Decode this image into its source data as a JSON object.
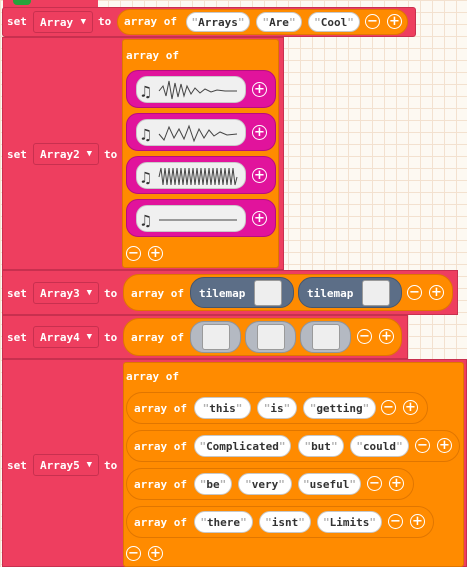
{
  "keywords": {
    "set": "set",
    "to": "to",
    "array_of": "array of"
  },
  "icons": {
    "remove": "minus-circle-icon",
    "add": "plus-circle-icon",
    "note": "music-note-icon",
    "dropdown": "triangle-down-icon"
  },
  "colors": {
    "set_block": "#ee3e5f",
    "array_block": "#ff8b00",
    "sound_block": "#e1139c",
    "tilemap_block": "#5c6e87",
    "image_block": "#b4b9c2"
  },
  "blocks": [
    {
      "variable": "Array",
      "items": [
        "Arrays",
        "Are",
        "Cool"
      ]
    },
    {
      "variable": "Array2",
      "items": [
        "sound-wave-1",
        "sound-wave-2",
        "sound-wave-3",
        "sound-wave-4"
      ]
    },
    {
      "variable": "Array3",
      "items": [
        "tilemap",
        "tilemap"
      ]
    },
    {
      "variable": "Array4",
      "items": [
        "image",
        "image",
        "image"
      ]
    },
    {
      "variable": "Array5",
      "rows": [
        [
          "this",
          "is",
          "getting"
        ],
        [
          "Complicated",
          "but",
          "could"
        ],
        [
          "be",
          "very",
          "useful"
        ],
        [
          "there",
          "isnt",
          "Limits"
        ]
      ]
    }
  ]
}
